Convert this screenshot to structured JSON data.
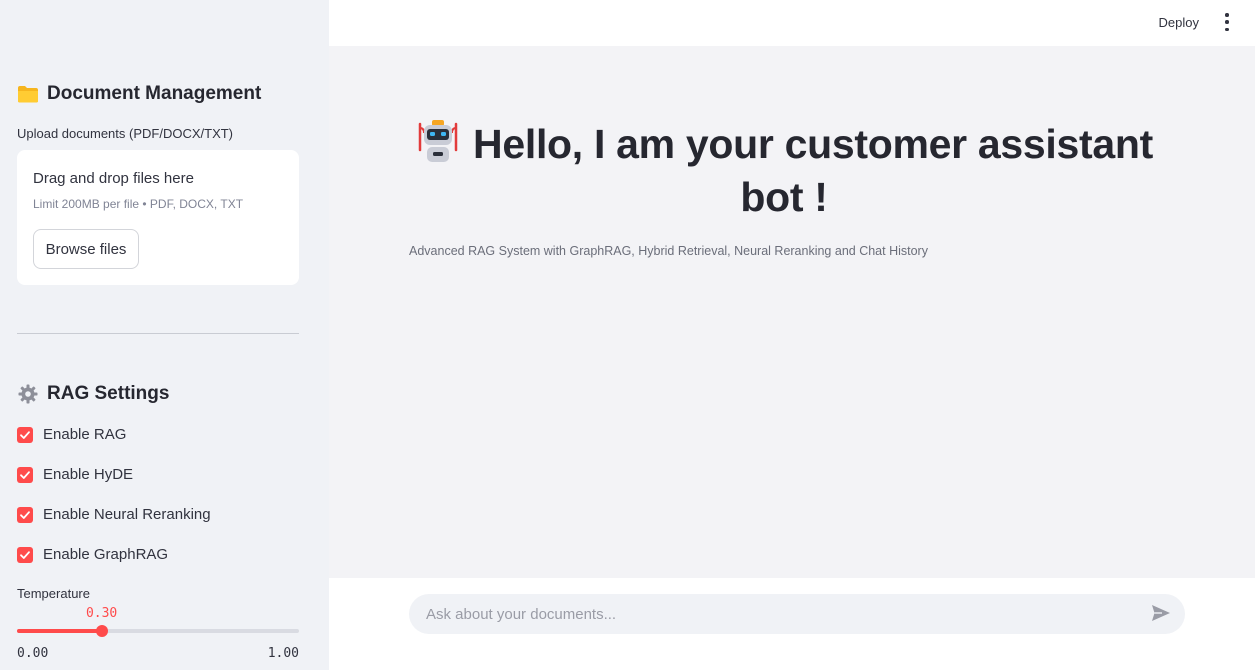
{
  "topbar": {
    "deploy_label": "Deploy",
    "menu_icon": "kebab-menu-icon"
  },
  "sidebar": {
    "document_section": {
      "icon": "folder-icon",
      "title": "Document Management",
      "upload_label": "Upload documents (PDF/DOCX/TXT)",
      "dropzone_title": "Drag and drop files here",
      "dropzone_limit": "Limit 200MB per file • PDF, DOCX, TXT",
      "browse_label": "Browse files"
    },
    "rag_section": {
      "icon": "gear-icon",
      "title": "RAG Settings",
      "options": [
        {
          "label": "Enable RAG",
          "checked": true
        },
        {
          "label": "Enable HyDE",
          "checked": true
        },
        {
          "label": "Enable Neural Reranking",
          "checked": true
        },
        {
          "label": "Enable GraphRAG",
          "checked": true
        }
      ]
    },
    "temperature": {
      "label": "Temperature",
      "value": 0.3,
      "value_text": "0.30",
      "min": 0,
      "max": 1,
      "min_text": "0.00",
      "max_text": "1.00"
    }
  },
  "main": {
    "hero_icon": "robot-icon",
    "title": "Hello, I am your customer assistant bot !",
    "subtitle": "Advanced RAG System with GraphRAG, Hybrid Retrieval, Neural Reranking and Chat History"
  },
  "chat": {
    "placeholder": "Ask about your documents...",
    "send_icon": "send-icon"
  },
  "colors": {
    "accent": "#ff4b4b",
    "sidebar_bg": "#f0f2f6",
    "main_bg": "#f3f3f6",
    "text": "#31333f"
  }
}
